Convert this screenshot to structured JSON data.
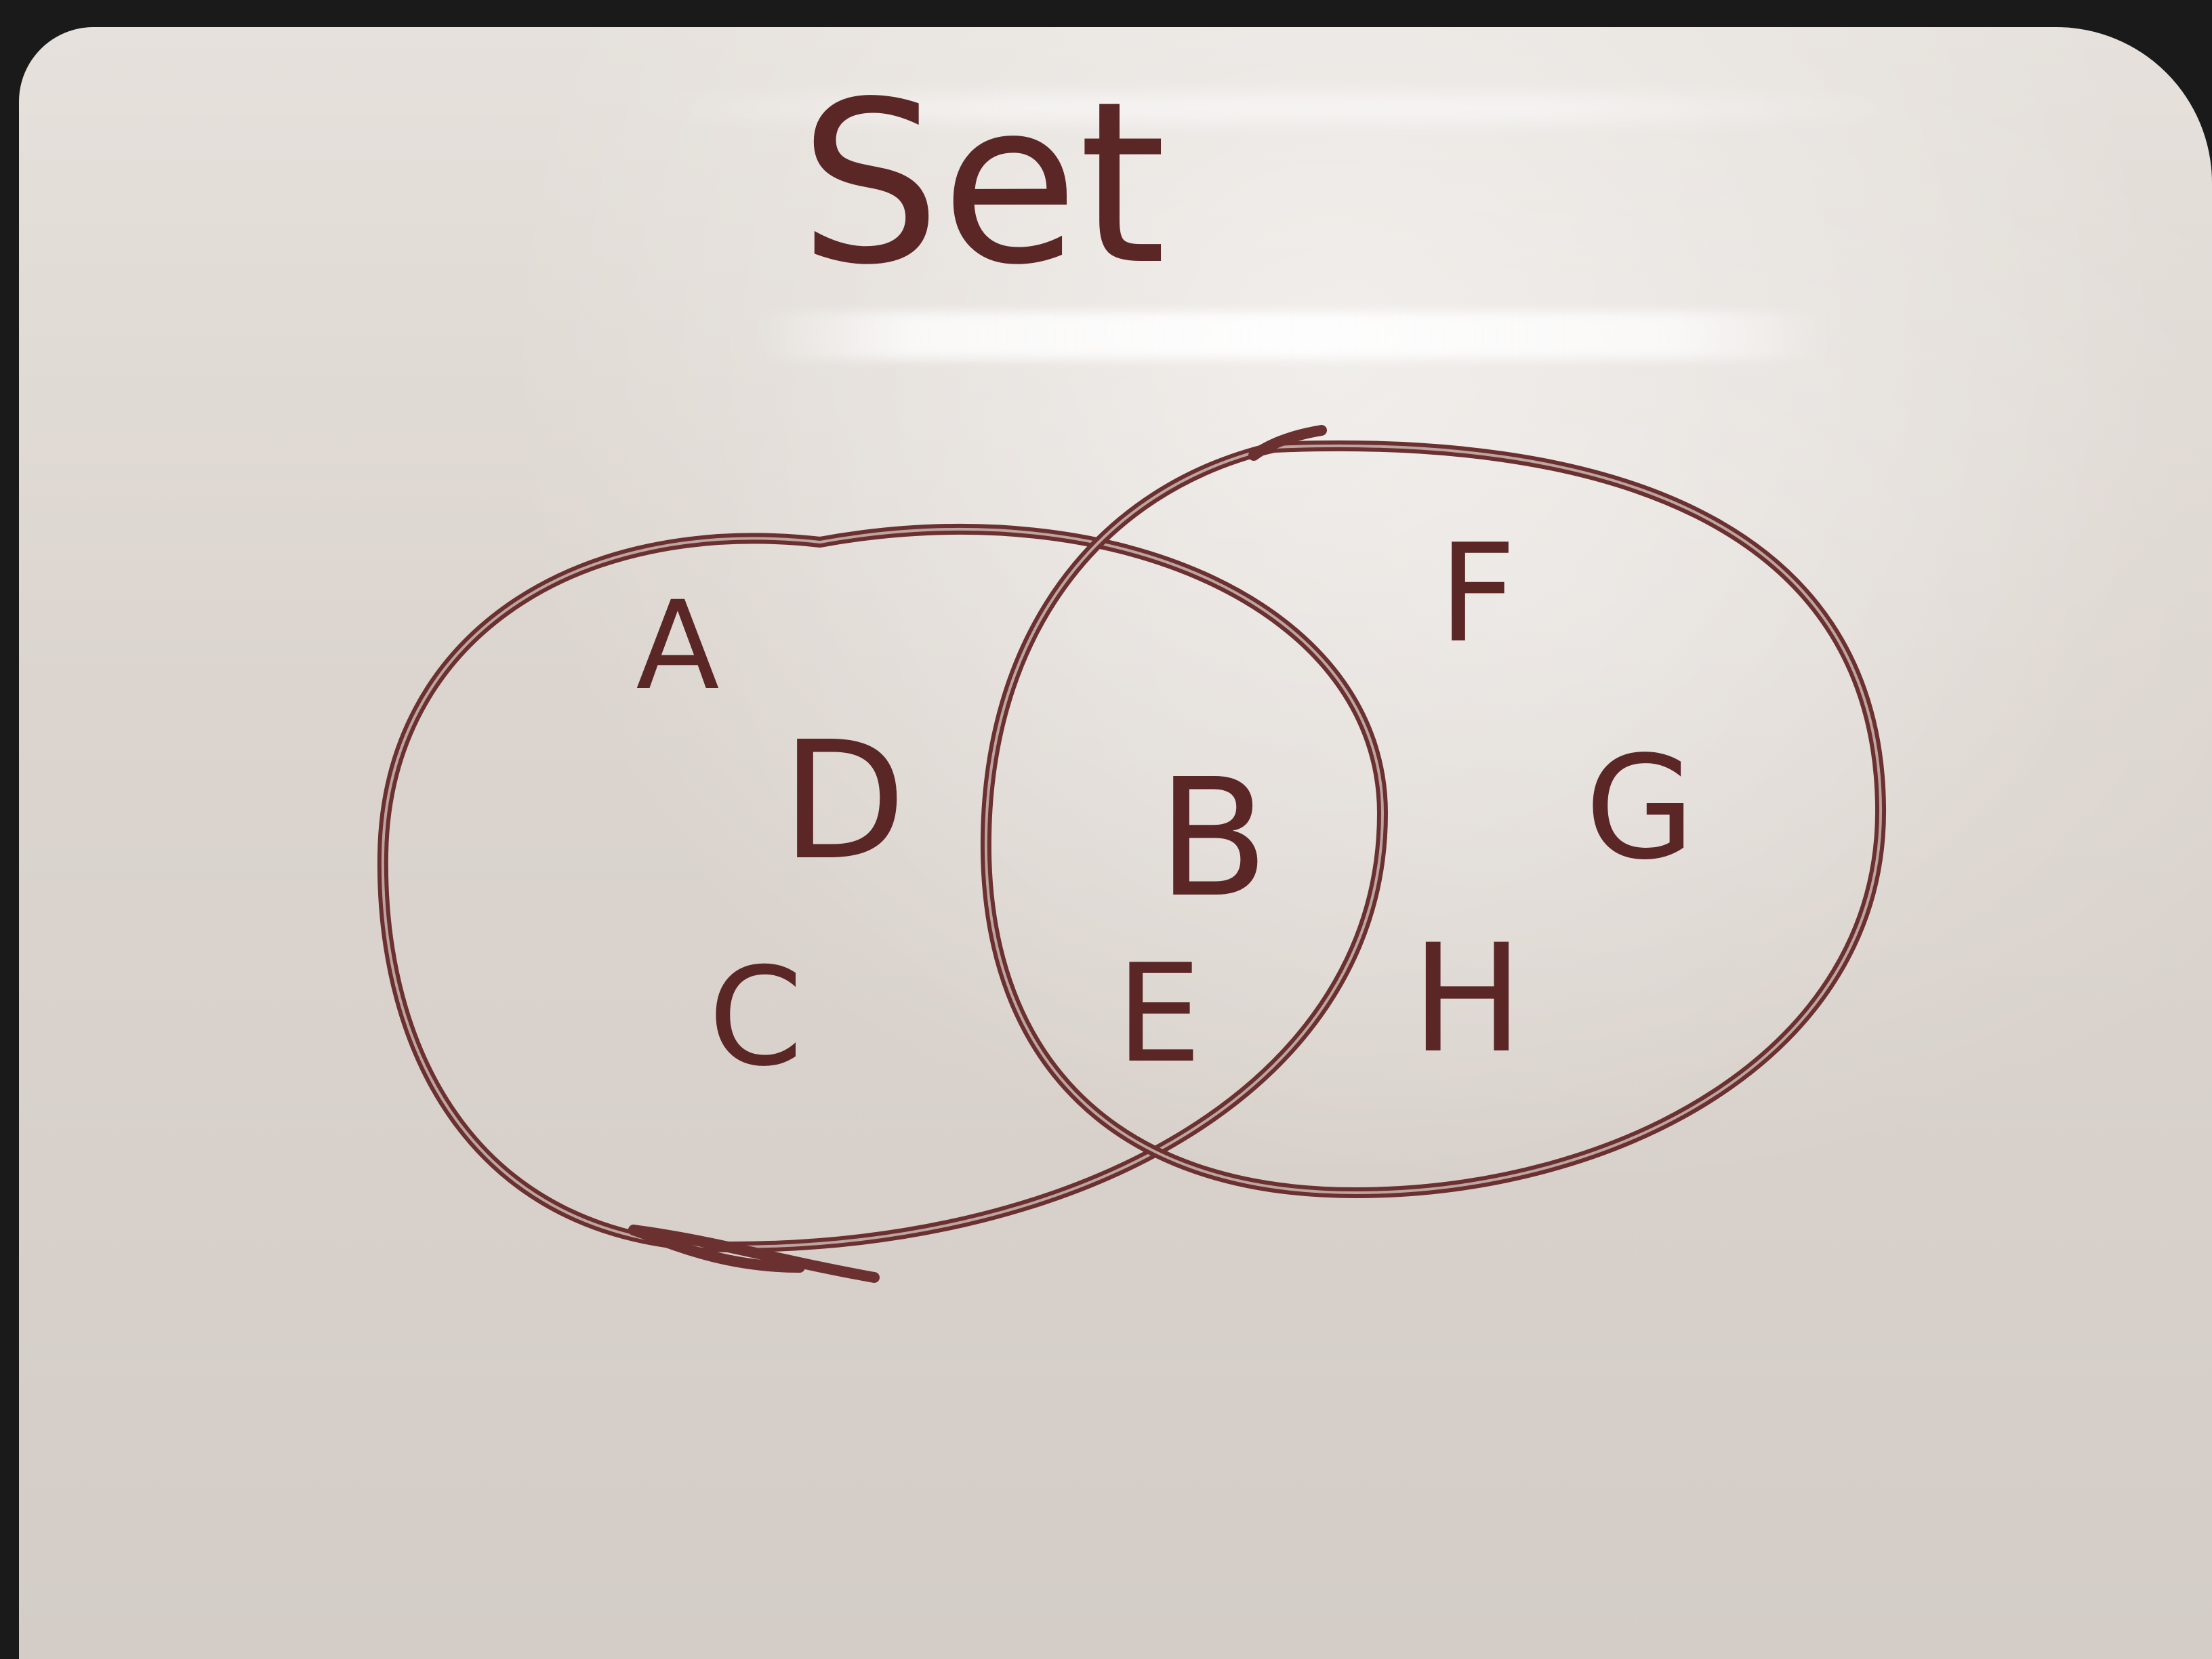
{
  "title": "Set",
  "sets": [
    {
      "elements": [
        {
          "label": "A",
          "name": "element-a"
        },
        {
          "label": "D",
          "name": "element-d"
        },
        {
          "label": "C",
          "name": "element-c"
        }
      ]
    },
    {
      "elements": [
        {
          "label": "F",
          "name": "element-f"
        },
        {
          "label": "G",
          "name": "element-g"
        },
        {
          "label": "H",
          "name": "element-h"
        }
      ]
    }
  ],
  "intersection": [
    {
      "label": "B",
      "name": "element-b"
    },
    {
      "label": "E",
      "name": "element-e"
    }
  ],
  "colors": {
    "marker": "#5a2626",
    "board": "#dcd5cf",
    "frame": "#1b1a1a"
  }
}
